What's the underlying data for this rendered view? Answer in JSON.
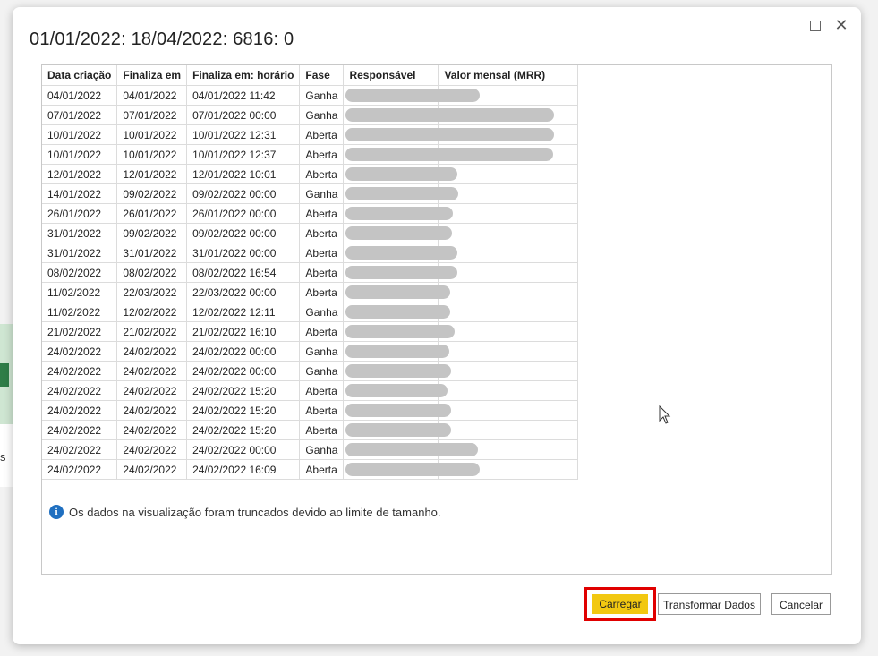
{
  "background": {
    "partial_text": "s"
  },
  "dialog": {
    "title": "01/01/2022: 18/04/2022: 6816: 0",
    "window_buttons": {
      "maximize_icon": "maximize-icon",
      "close_icon": "close-icon",
      "close_glyph": "✕"
    }
  },
  "table": {
    "columns": [
      "Data criação",
      "Finaliza em",
      "Finaliza em: horário",
      "Fase",
      "Responsável",
      "Valor mensal (MRR)"
    ],
    "rows": [
      [
        "04/01/2022",
        "04/01/2022",
        "04/01/2022 11:42",
        "Ganha"
      ],
      [
        "07/01/2022",
        "07/01/2022",
        "07/01/2022 00:00",
        "Ganha"
      ],
      [
        "10/01/2022",
        "10/01/2022",
        "10/01/2022 12:31",
        "Aberta"
      ],
      [
        "10/01/2022",
        "10/01/2022",
        "10/01/2022 12:37",
        "Aberta"
      ],
      [
        "12/01/2022",
        "12/01/2022",
        "12/01/2022 10:01",
        "Aberta"
      ],
      [
        "14/01/2022",
        "09/02/2022",
        "09/02/2022 00:00",
        "Ganha"
      ],
      [
        "26/01/2022",
        "26/01/2022",
        "26/01/2022 00:00",
        "Aberta"
      ],
      [
        "31/01/2022",
        "09/02/2022",
        "09/02/2022 00:00",
        "Aberta"
      ],
      [
        "31/01/2022",
        "31/01/2022",
        "31/01/2022 00:00",
        "Aberta"
      ],
      [
        "08/02/2022",
        "08/02/2022",
        "08/02/2022 16:54",
        "Aberta"
      ],
      [
        "11/02/2022",
        "22/03/2022",
        "22/03/2022 00:00",
        "Aberta"
      ],
      [
        "11/02/2022",
        "12/02/2022",
        "12/02/2022 12:11",
        "Ganha"
      ],
      [
        "21/02/2022",
        "21/02/2022",
        "21/02/2022 16:10",
        "Aberta"
      ],
      [
        "24/02/2022",
        "24/02/2022",
        "24/02/2022 00:00",
        "Ganha"
      ],
      [
        "24/02/2022",
        "24/02/2022",
        "24/02/2022 00:00",
        "Ganha"
      ],
      [
        "24/02/2022",
        "24/02/2022",
        "24/02/2022 15:20",
        "Aberta"
      ],
      [
        "24/02/2022",
        "24/02/2022",
        "24/02/2022 15:20",
        "Aberta"
      ],
      [
        "24/02/2022",
        "24/02/2022",
        "24/02/2022 15:20",
        "Aberta"
      ],
      [
        "24/02/2022",
        "24/02/2022",
        "24/02/2022 00:00",
        "Ganha"
      ],
      [
        "24/02/2022",
        "24/02/2022",
        "24/02/2022 16:09",
        "Aberta"
      ]
    ]
  },
  "info": {
    "icon": "info-icon",
    "text": "Os dados na visualização foram truncados devido ao limite de tamanho."
  },
  "buttons": {
    "load": "Carregar",
    "transform": "Transformar Dados",
    "cancel": "Cancelar"
  },
  "colors": {
    "load_button": "#f2c811",
    "highlight_border": "#e00000",
    "info_icon": "#1f6fc0"
  }
}
